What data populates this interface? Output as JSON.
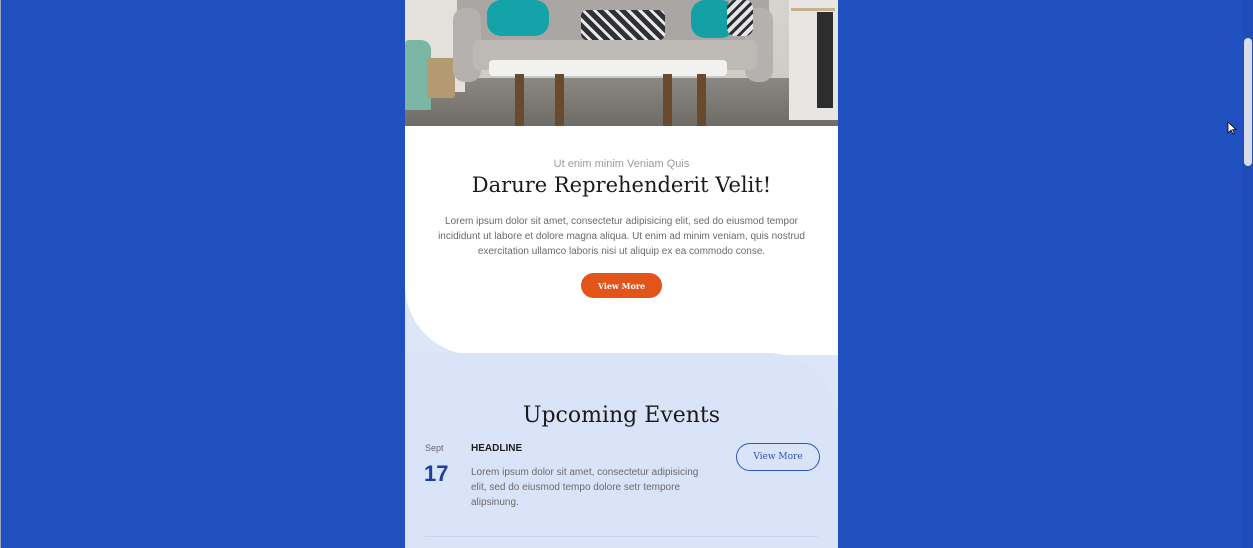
{
  "colors": {
    "page_background": "#2050bf",
    "accent_orange": "#e3541b",
    "date_blue": "#1f3fa8",
    "events_background": "#dae4f9"
  },
  "hero": {
    "image_icon": "living-room-sofa-image"
  },
  "intro": {
    "subtitle": "Ut enim minim Veniam Quis",
    "headline": "Darure Reprehenderit Velit!",
    "body": "Lorem ipsum dolor sit amet, consectetur adipisicing elit, sed do eiusmod tempor incididunt ut labore et dolore magna aliqua. Ut enim ad minim veniam, quis nostrud exercitation ullamco laboris nisi ut aliquip ex ea commodo conse.",
    "button_label": "View More"
  },
  "events": {
    "title": "Upcoming Events",
    "items": [
      {
        "month": "Sept",
        "day": "17",
        "headline": "HEADLINE",
        "body": "Lorem ipsum dolor sit amet, consectetur adipisicing elit, sed do eiusmod tempo dolore setr tempore alipsinung.",
        "button_label": "View More"
      }
    ]
  }
}
